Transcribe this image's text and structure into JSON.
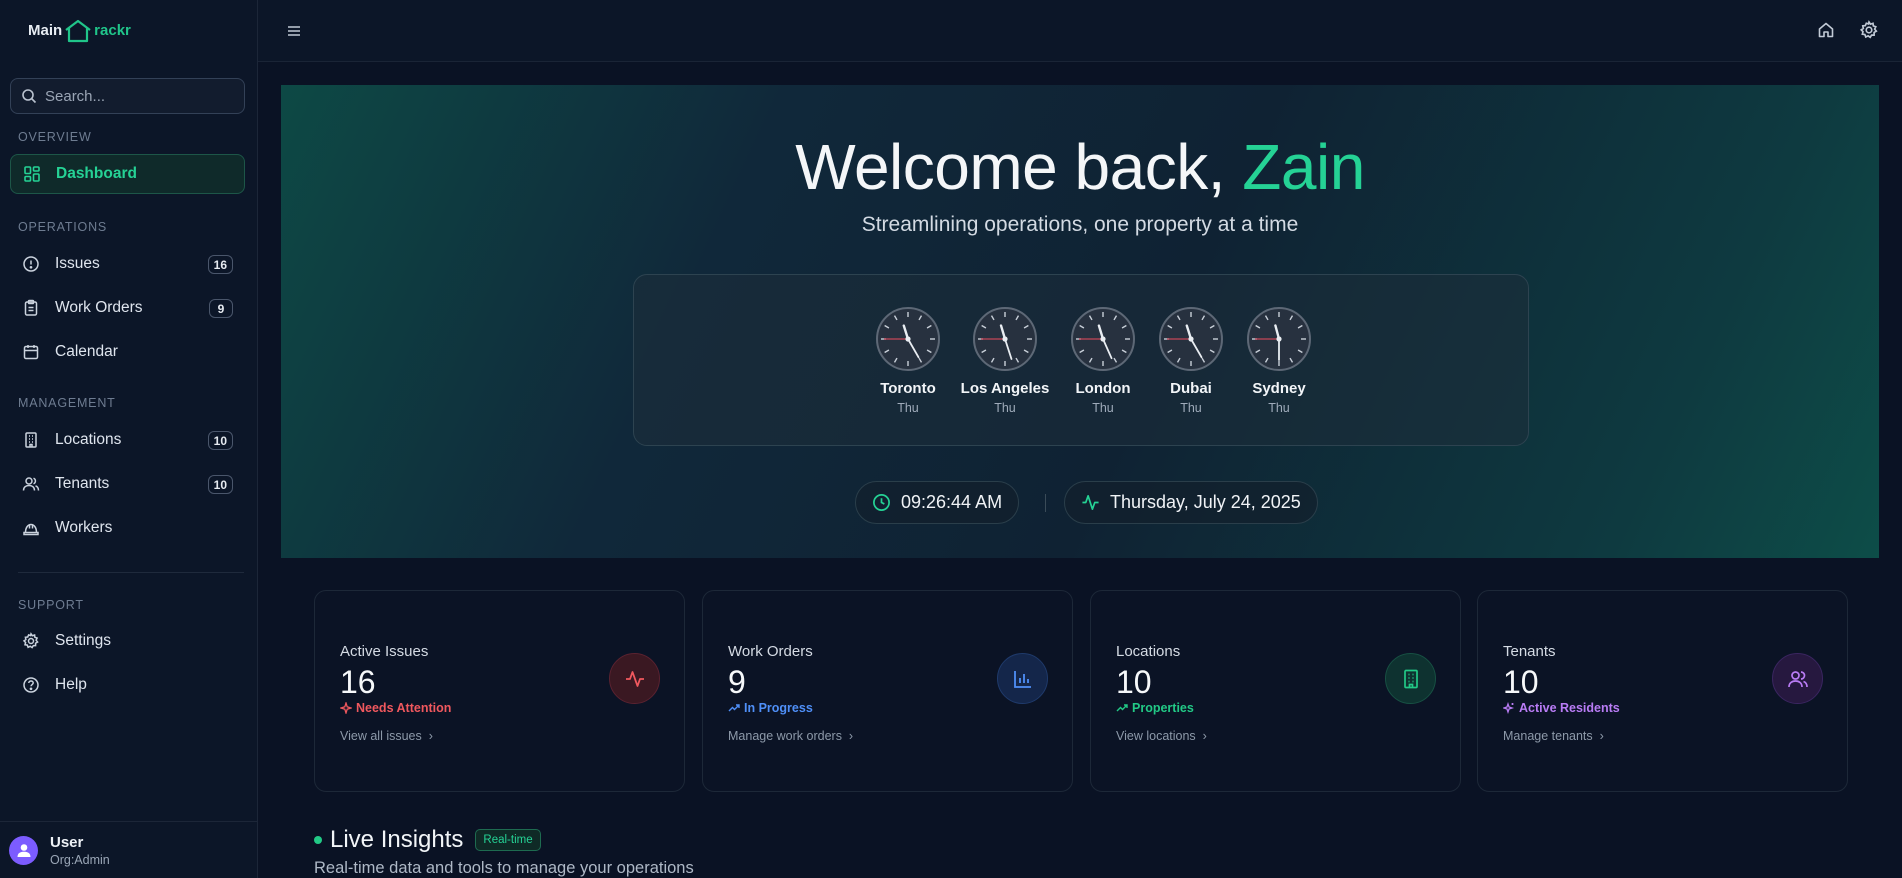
{
  "brand": {
    "prefix": "Main",
    "suffix": "rackr",
    "accent": "#20c58a"
  },
  "search": {
    "placeholder": "Search..."
  },
  "sidebar": {
    "sections": {
      "overview": "OVERVIEW",
      "operations": "OPERATIONS",
      "management": "MANAGEMENT",
      "support": "SUPPORT"
    },
    "items": [
      {
        "label": "Dashboard",
        "icon": "dashboard-icon",
        "active": true
      },
      {
        "label": "Issues",
        "icon": "alert-circle-icon",
        "badge": "16"
      },
      {
        "label": "Work Orders",
        "icon": "clipboard-icon",
        "badge": "9"
      },
      {
        "label": "Calendar",
        "icon": "calendar-icon"
      },
      {
        "label": "Locations",
        "icon": "building-icon",
        "badge": "10"
      },
      {
        "label": "Tenants",
        "icon": "users-icon",
        "badge": "10"
      },
      {
        "label": "Workers",
        "icon": "hard-hat-icon"
      },
      {
        "label": "Settings",
        "icon": "gear-icon"
      },
      {
        "label": "Help",
        "icon": "help-circle-icon"
      }
    ]
  },
  "user": {
    "name": "User",
    "role": "Org:Admin"
  },
  "hero": {
    "greeting": "Welcome back, ",
    "name": "Zain",
    "tagline": "Streamlining operations, one property at a time",
    "clocks": [
      {
        "city": "Toronto",
        "day": "Thu"
      },
      {
        "city": "Los Angeles",
        "day": "Thu"
      },
      {
        "city": "London",
        "day": "Thu"
      },
      {
        "city": "Dubai",
        "day": "Thu"
      },
      {
        "city": "Sydney",
        "day": "Thu"
      }
    ],
    "time": "09:26:44 AM",
    "date": "Thursday, July 24, 2025"
  },
  "stats": [
    {
      "label": "Active Issues",
      "value": "16",
      "tag": "Needs Attention",
      "link": "View all issues",
      "color": "#f0585e",
      "icon": "activity-icon"
    },
    {
      "label": "Work Orders",
      "value": "9",
      "tag": "In Progress",
      "link": "Manage work orders",
      "color": "#4f8ff7",
      "icon": "bar-chart-icon"
    },
    {
      "label": "Locations",
      "value": "10",
      "tag": "Properties",
      "link": "View locations",
      "color": "#22c986",
      "icon": "building-icon"
    },
    {
      "label": "Tenants",
      "value": "10",
      "tag": "Active Residents",
      "link": "Manage tenants",
      "color": "#b97cf5",
      "icon": "users-icon"
    }
  ],
  "insights": {
    "title": "Live Insights",
    "badge": "Real-time",
    "subtitle": "Real-time data and tools to manage your operations"
  }
}
